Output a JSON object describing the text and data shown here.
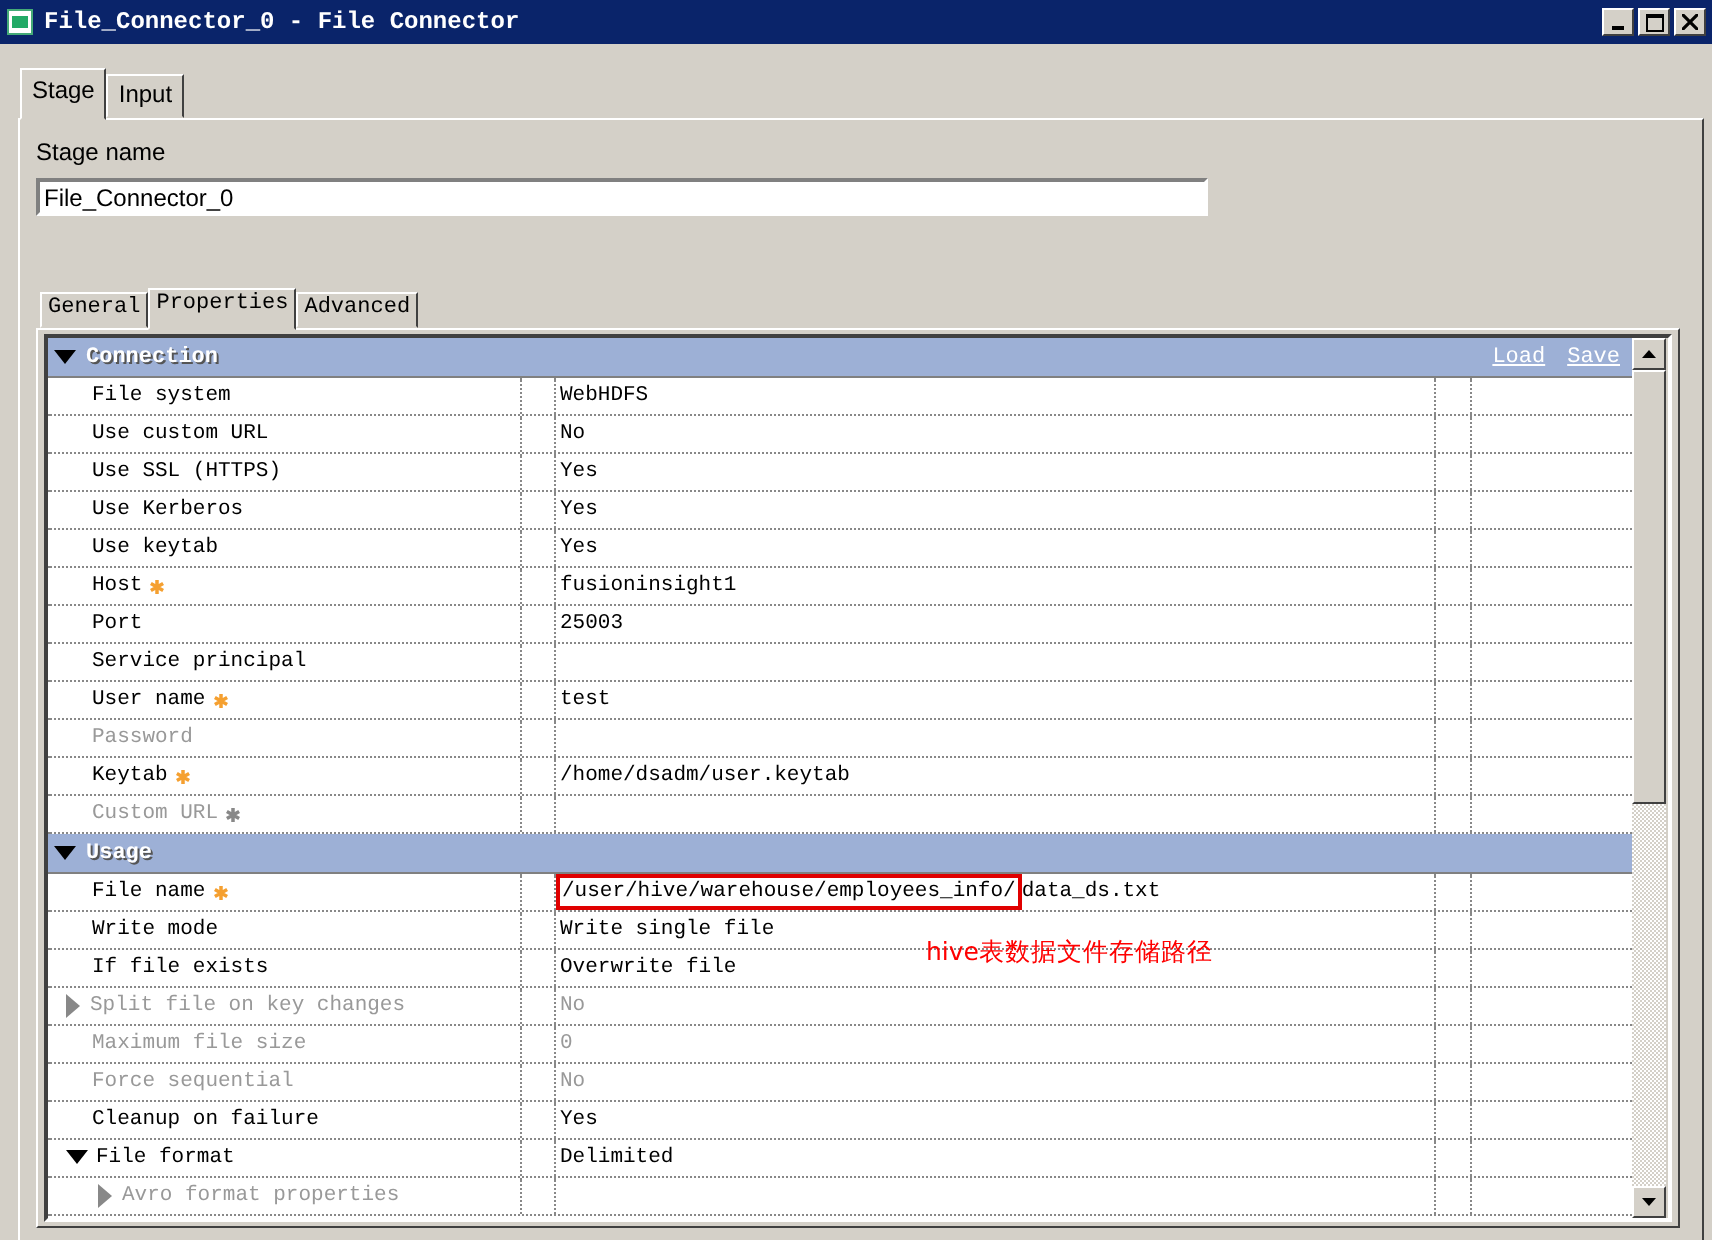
{
  "window": {
    "title": "File_Connector_0 - File Connector"
  },
  "tabs": [
    {
      "label": "Stage",
      "selected": true
    },
    {
      "label": "Input",
      "selected": false
    }
  ],
  "stage_name": {
    "label": "Stage name",
    "value": "File_Connector_0"
  },
  "property_tabs": [
    {
      "label": "General",
      "selected": false
    },
    {
      "label": "Properties",
      "selected": true
    },
    {
      "label": "Advanced",
      "selected": false
    }
  ],
  "property_links": [
    "Load",
    "Save"
  ],
  "sections": [
    {
      "title": "Connection",
      "expanded": true,
      "rows": [
        {
          "name": "File system",
          "value": "WebHDFS",
          "required": false,
          "disabled": false
        },
        {
          "name": "Use custom URL",
          "value": "No",
          "required": false,
          "disabled": false
        },
        {
          "name": "Use SSL (HTTPS)",
          "value": "Yes",
          "required": false,
          "disabled": false
        },
        {
          "name": "Use Kerberos",
          "value": "Yes",
          "required": false,
          "disabled": false
        },
        {
          "name": "Use keytab",
          "value": "Yes",
          "required": false,
          "disabled": false
        },
        {
          "name": "Host",
          "value": "fusioninsight1",
          "required": true,
          "disabled": false
        },
        {
          "name": "Port",
          "value": "25003",
          "required": false,
          "disabled": false
        },
        {
          "name": "Service principal",
          "required": false,
          "disabled": false
        },
        {
          "name": "User name",
          "value": "test",
          "required": true,
          "disabled": false
        },
        {
          "name": "Password",
          "required": false,
          "disabled": true
        },
        {
          "name": "Keytab",
          "value": "/home/dsadm/user.keytab",
          "required": true,
          "disabled": false
        },
        {
          "name": "Custom URL",
          "required": true,
          "disabled": true
        }
      ]
    },
    {
      "title": "Usage",
      "expanded": true,
      "rows": [
        {
          "name": "File name",
          "value_parts": [
            {
              "text": "/user/hive/warehouse/employees_info/",
              "highlighted": true
            },
            {
              "text": "data_ds.txt",
              "highlighted": false
            }
          ],
          "required": true,
          "disabled": false
        },
        {
          "name": "Write mode",
          "value": "Write single file",
          "required": false,
          "disabled": false
        },
        {
          "name": "If file exists",
          "value": "Overwrite file",
          "required": false,
          "disabled": false
        },
        {
          "name": "Split file on key changes",
          "value": "No",
          "required": false,
          "disabled": true,
          "expanded": false
        },
        {
          "name": "Maximum file size",
          "value": "0",
          "required": false,
          "disabled": true
        },
        {
          "name": "Force sequential",
          "value": "No",
          "required": false,
          "disabled": true
        },
        {
          "name": "Cleanup on failure",
          "value": "Yes",
          "required": false,
          "disabled": false
        },
        {
          "name": "File format",
          "value": "Delimited",
          "required": false,
          "disabled": false,
          "expanded": true,
          "children": [
            {
              "name": "Avro format properties",
              "required": false,
              "disabled": true,
              "expanded": false
            }
          ]
        }
      ]
    }
  ],
  "annotation": {
    "text": "hive表数据文件存储路径"
  }
}
